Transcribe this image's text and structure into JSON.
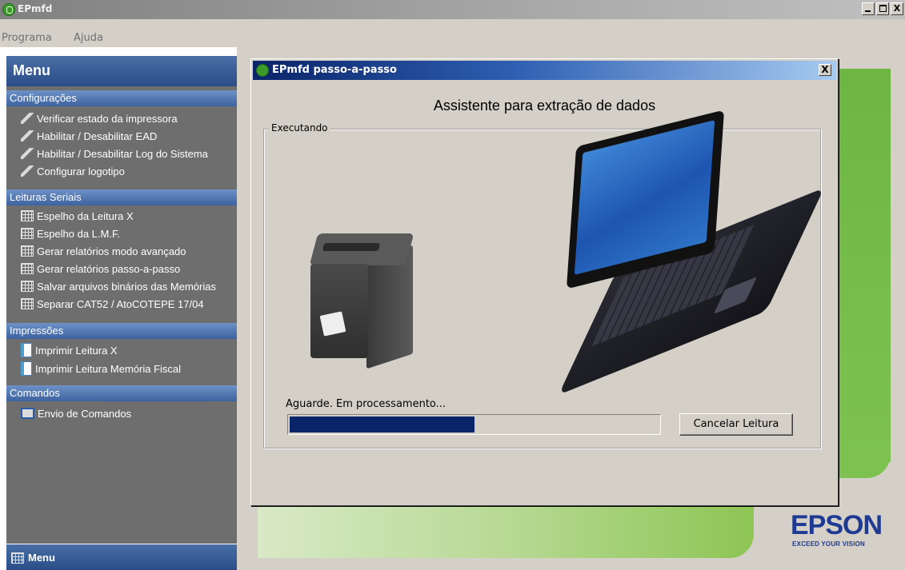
{
  "window": {
    "title": "EPmfd",
    "minimize_label": "_",
    "maximize_label": "□",
    "close_label": "X"
  },
  "menubar": {
    "items": [
      "Programa",
      "Ajuda"
    ]
  },
  "sidebar": {
    "title": "Menu",
    "sections": [
      {
        "label": "Configurações",
        "icon": "pen-icon",
        "items": [
          "Verificar estado da impressora",
          "Habilitar / Desabilitar EAD",
          "Habilitar / Desabilitar Log do Sistema",
          "Configurar logotipo"
        ]
      },
      {
        "label": "Leituras Seriais",
        "icon": "grid-icon",
        "items": [
          "Espelho da Leitura X",
          "Espelho da L.M.F.",
          "Gerar relatórios modo avançado",
          "Gerar relatórios passo-a-passo",
          "Salvar arquivos binários das Memórias",
          "Separar CAT52 / AtoCOTEPE 17/04"
        ]
      },
      {
        "label": "Impressões",
        "icon": "page-icon",
        "items": [
          "Imprimir Leitura X",
          "Imprimir Leitura Memória Fiscal"
        ]
      },
      {
        "label": "Comandos",
        "icon": "monitor-icon",
        "items": [
          "Envio de Comandos"
        ]
      }
    ],
    "footer_label": "Menu"
  },
  "dialog": {
    "title": "EPmfd passo-a-passo",
    "close_label": "X",
    "heading": "Assistente para extração de dados",
    "group_label": "Executando",
    "status": "Aguarde. Em processamento...",
    "progress_fraction": 0.5,
    "cancel_label": "Cancelar Leitura"
  },
  "branding": {
    "logo": "EPSON",
    "tagline": "EXCEED YOUR VISION",
    "accent_green": "#6db641",
    "title_blue": "#0a246a"
  }
}
